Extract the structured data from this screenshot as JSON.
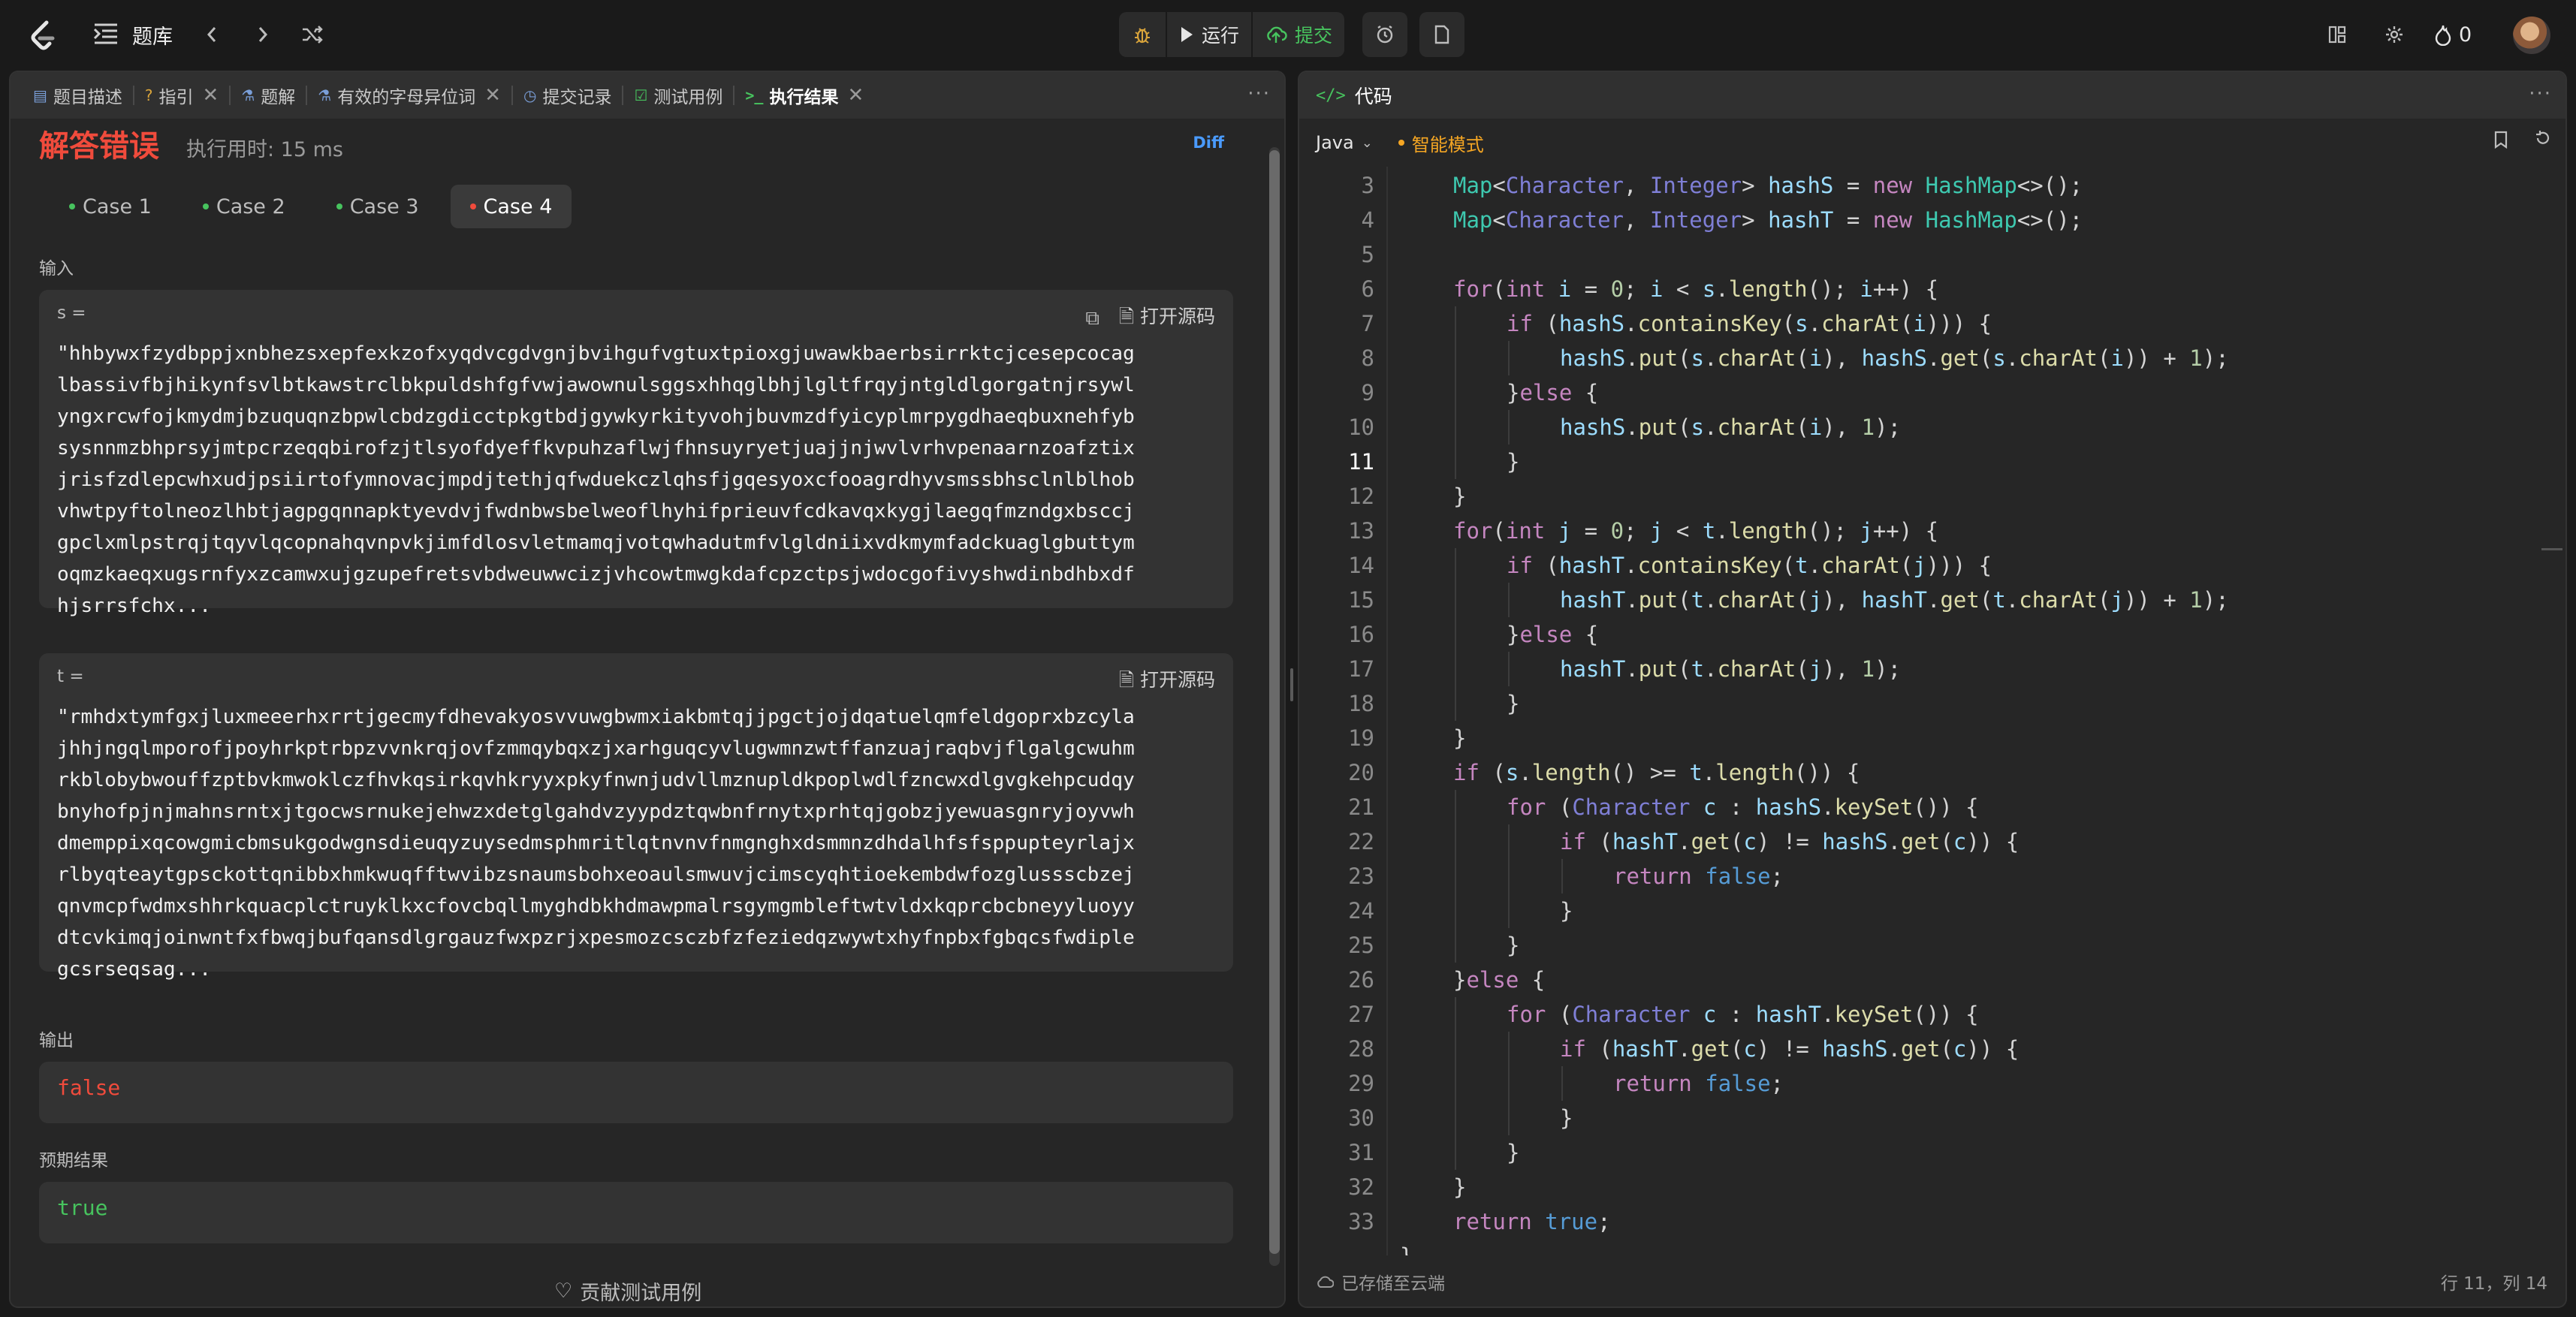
{
  "topbar": {
    "problem_list": "题库",
    "debug_label": "",
    "run_label": "运行",
    "submit_label": "提交",
    "streak_count": "0"
  },
  "left_tabs": [
    {
      "label": "题目描述",
      "icon": "description-icon",
      "closable": false
    },
    {
      "label": "指引",
      "icon": "help-circle-icon",
      "closable": true
    },
    {
      "label": "题解",
      "icon": "flask-icon",
      "closable": false
    },
    {
      "label": "有效的字母异位词",
      "icon": "flask-icon",
      "closable": true
    },
    {
      "label": "提交记录",
      "icon": "history-icon",
      "closable": false
    },
    {
      "label": "测试用例",
      "icon": "checkbox-icon",
      "closable": false
    },
    {
      "label": "执行结果",
      "icon": "terminal-icon",
      "closable": true,
      "active": true
    }
  ],
  "result": {
    "verdict": "解答错误",
    "runtime": "执行用时: 15 ms",
    "diff": "Diff",
    "cases": [
      "Case 1",
      "Case 2",
      "Case 3",
      "Case 4"
    ],
    "input_label": "输入",
    "s_name": "s =",
    "t_name": "t =",
    "open_source": "打开源码",
    "s_lines": [
      "\"hhbywxfzydbppjxnbhezsxepfexkzofxyqdvcgdvgnjbvihgufvgtuxtpioxgjuwawkbaerbsirrktcjcesepcocag",
      "lbassivfbjhikynfsvlbtkawstrclbkpuldshfgfvwjawownulsggsxhhqglbhjlgltfrqyjntgldlgorgatnjrsywl",
      "yngxrcwfojkmydmjbzuquqnzbpwlcbdzgdicctpkgtbdjgywkyrkityvohjbuvmzdfyicyplmrpygdhaeqbuxnehfyb",
      "sysnnmzbhprsyjmtpcrzeqqbirofzjtlsyofdyeffkvpuhzaflwjfhnsuyryetjuajjnjwvlvrhvpenaarnzoafztix",
      "jrisfzdlepcwhxudjpsiirtofymnovacjmpdjtethjqfwduekczlqhsfjgqesyoxcfooagrdhyvsmssbhsclnlblhob",
      "vhwtpyftolneozlhbtjagpgqnnapktyevdvjfwdnbwsbelweoflhyhifprieuvfcdkavqxkygjlaegqfmzndgxbsccj",
      "gpclxmlpstrqjtqyvlqcopnahqvnpvkjimfdlosvletmamqjvotqwhadutmfvlgldniixvdkmymfadckuaglgbuttym",
      "oqmzkaeqxugsrnfyxzcamwxujgzupefretsvbdweuwwcizjvhcowtmwgkdafcpzctpsjwdocgofivyshwdinbdhbxdf",
      "hjsrrsfchx..."
    ],
    "t_lines": [
      "\"rmhdxtymfgxjluxmeeerhxrrtjgecmyfdhevakyosvvuwgbwmxiakbmtqjjpgctjojdqatuelqmfeldgoprxbzcyla",
      "jhhjngqlmporofjpoyhrkptrbpzvvnkrqjovfzmmqybqxzjxarhguqcyvlugwmnzwtffanzuajraqbvjflgalgcwuhm",
      "rkblobybwouffzptbvkmwoklczfhvkqsirkqvhkryyxpkyfnwnjudvllmznupldkpoplwdlfzncwxdlgvgkehpcudqy",
      "bnyhofpjnjmahnsrntxjtgocwsrnukejehwzxdetglgahdvzyypdztqwbnfrnytxprhtqjgobzjyewuasgnryjoyvwh",
      "dmemppixqcowgmicbmsukgodwgnsdieuqyzuysedmsphmritlqtnvnvfnmgnghxdsmmnzdhdalhfsfsppupteyrlajx",
      "rlbyqteaytgpsckottqnibbxhmkwuqfftwvibzsnaumsbohxeoaulsmwuvjcimscyqhtioekembdwfozglussscbzej",
      "qnvmcpfwdmxshhrkquacplctruyklkxcfovcbqllmyghdbkhdmawpmalrsgymgmbleftwtvldxkqprcbcbneyyluoyy",
      "dtcvkimqjoinwntfxfbwqjbufqansdlgrgauzfwxpzrjxpesmozcsczbfzfeziedqzwywtxhyfnpbxfgbqcsfwdiple",
      "gcsrseqsag..."
    ],
    "output_label": "输出",
    "output_value": "false",
    "expected_label": "预期结果",
    "expected_value": "true",
    "contribute": "贡献测试用例"
  },
  "editor": {
    "title": "代码",
    "language": "Java",
    "mode": "智能模式",
    "saved": "已存储至云端",
    "cursor": "行 11，列 14",
    "current_line": 11
  },
  "code_lines": [
    {
      "n": "3",
      "indent": 2
    },
    {
      "n": "4",
      "indent": 2
    },
    {
      "n": "5",
      "indent": 2
    },
    {
      "n": "6",
      "indent": 2
    },
    {
      "n": "7",
      "indent": 3
    },
    {
      "n": "8",
      "indent": 4
    },
    {
      "n": "9",
      "indent": 3
    },
    {
      "n": "10",
      "indent": 4
    },
    {
      "n": "11",
      "indent": 3
    },
    {
      "n": "12",
      "indent": 2
    },
    {
      "n": "13",
      "indent": 2
    },
    {
      "n": "14",
      "indent": 3
    },
    {
      "n": "15",
      "indent": 4
    },
    {
      "n": "16",
      "indent": 3
    },
    {
      "n": "17",
      "indent": 4
    },
    {
      "n": "18",
      "indent": 3
    },
    {
      "n": "19",
      "indent": 2
    },
    {
      "n": "20",
      "indent": 2
    },
    {
      "n": "21",
      "indent": 3
    },
    {
      "n": "22",
      "indent": 4
    },
    {
      "n": "23",
      "indent": 5
    },
    {
      "n": "24",
      "indent": 4
    },
    {
      "n": "25",
      "indent": 3
    },
    {
      "n": "26",
      "indent": 2
    },
    {
      "n": "27",
      "indent": 3
    },
    {
      "n": "28",
      "indent": 4
    },
    {
      "n": "29",
      "indent": 5
    },
    {
      "n": "30",
      "indent": 4
    },
    {
      "n": "31",
      "indent": 3
    },
    {
      "n": "32",
      "indent": 2
    },
    {
      "n": "33",
      "indent": 2
    },
    {
      "n": "",
      "indent": 1
    }
  ],
  "code_text": [
    "Map<Character, Integer> hashS = new HashMap<>();",
    "Map<Character, Integer> hashT = new HashMap<>();",
    "",
    "for(int i = 0; i < s.length(); i++) {",
    "if (hashS.containsKey(s.charAt(i))) {",
    "hashS.put(s.charAt(i), hashS.get(s.charAt(i)) + 1);",
    "}else {",
    "hashS.put(s.charAt(i), 1);",
    "}",
    "}",
    "for(int j = 0; j < t.length(); j++) {",
    "if (hashT.containsKey(t.charAt(j))) {",
    "hashT.put(t.charAt(j), hashT.get(t.charAt(j)) + 1);",
    "}else {",
    "hashT.put(t.charAt(j), 1);",
    "}",
    "}",
    "if (s.length() >= t.length()) {",
    "for (Character c : hashS.keySet()) {",
    "if (hashT.get(c) != hashS.get(c)) {",
    "return false;",
    "}",
    "}",
    "}else {",
    "for (Character c : hashT.keySet()) {",
    "if (hashT.get(c) != hashS.get(c)) {",
    "return false;",
    "}",
    "}",
    "}",
    "return true;",
    "}"
  ]
}
